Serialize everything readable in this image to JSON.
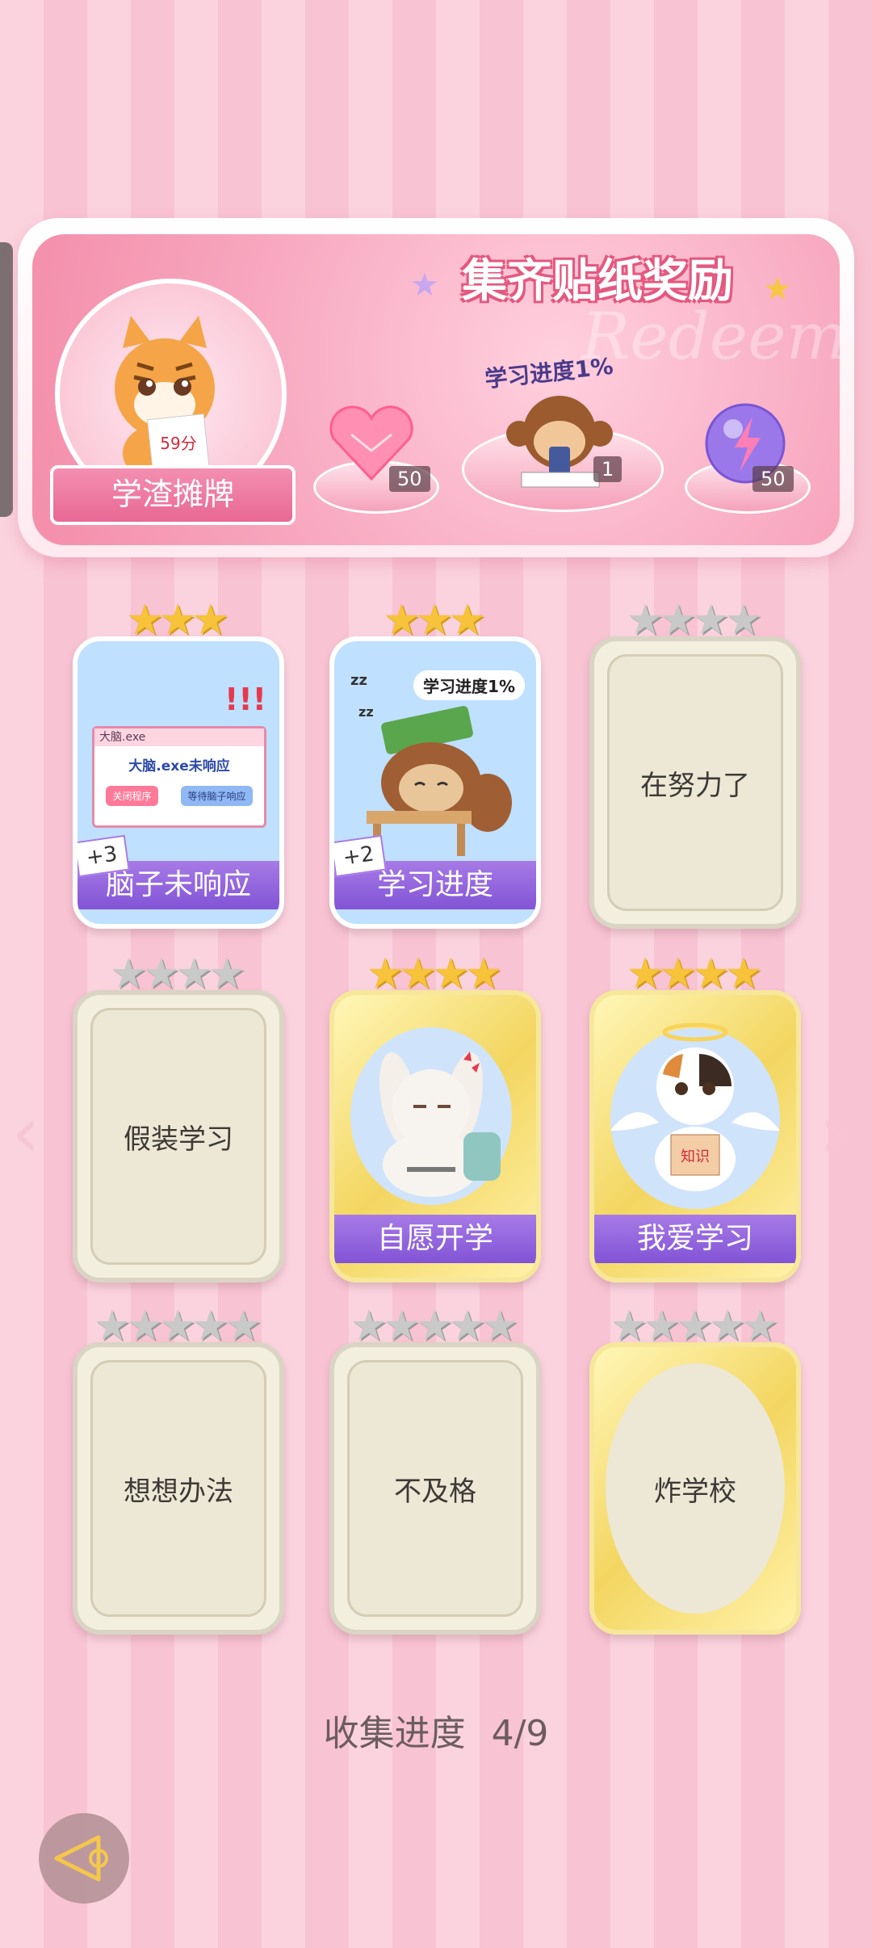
{
  "banner": {
    "title": "集齐贴纸奖励",
    "watermark": "Redeem",
    "badge_label": "学渣摊牌",
    "tiger_score": "59分",
    "sub_label": "学习进度1%",
    "rewards": [
      {
        "name": "heart-gem",
        "count": "50"
      },
      {
        "name": "monkey-sticker",
        "count": "1"
      },
      {
        "name": "energy-orb",
        "count": "50"
      }
    ]
  },
  "cards": [
    {
      "label": "脑子未响应",
      "stars_on": 3,
      "stars_total": 3,
      "state": "collected",
      "plus": "+3",
      "art": {
        "window_title": "大脑.exe",
        "message": "大脑.exe未响应",
        "btn_close": "关闭程序",
        "btn_wait": "等待脑子响应",
        "exclaim": "!!!"
      }
    },
    {
      "label": "学习进度",
      "stars_on": 3,
      "stars_total": 3,
      "state": "collected",
      "plus": "+2",
      "art": {
        "bubble": "学习进度1%",
        "zz": "zz",
        "zz2": "zz"
      }
    },
    {
      "label": "在努力了",
      "stars_on": 0,
      "stars_total": 4,
      "state": "locked"
    },
    {
      "label": "假装学习",
      "stars_on": 0,
      "stars_total": 4,
      "state": "locked"
    },
    {
      "label": "自愿开学",
      "stars_on": 4,
      "stars_total": 4,
      "state": "collected-gold"
    },
    {
      "label": "我爱学习",
      "stars_on": 4,
      "stars_total": 4,
      "state": "collected-gold",
      "art": {
        "book_text": "知识"
      }
    },
    {
      "label": "想想办法",
      "stars_on": 0,
      "stars_total": 5,
      "state": "locked"
    },
    {
      "label": "不及格",
      "stars_on": 0,
      "stars_total": 5,
      "state": "locked"
    },
    {
      "label": "炸学校",
      "stars_on": 0,
      "stars_total": 5,
      "state": "locked-gold"
    }
  ],
  "progress": {
    "label": "收集进度",
    "value": "4/9"
  },
  "colors": {
    "accent_pink": "#e4587f",
    "label_purple": "#8254d6",
    "star_gold": "#f6c33a"
  }
}
